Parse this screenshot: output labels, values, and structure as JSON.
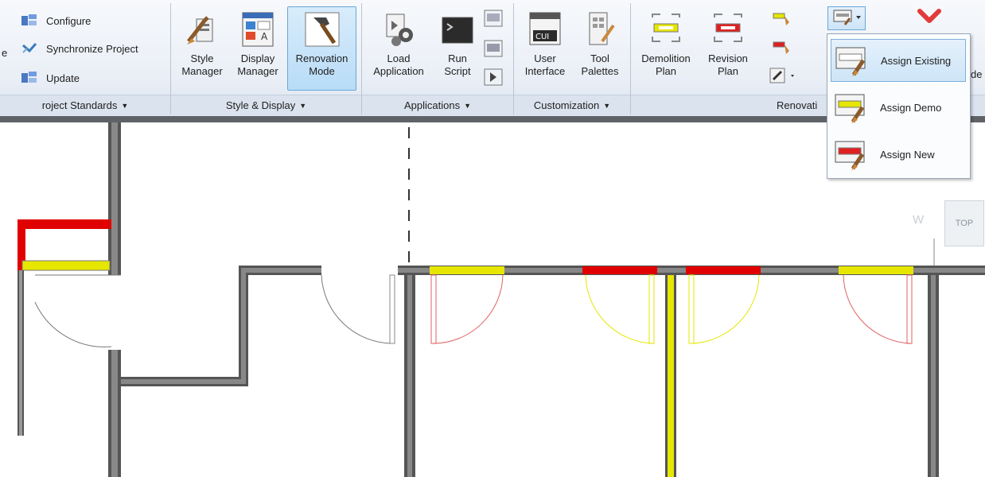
{
  "ribbon": {
    "project_standards": {
      "items": [
        "Configure",
        "Synchronize Project",
        "Update"
      ],
      "left_fragment_top": "",
      "left_fragment_mid": "e",
      "panel_label": "roject Standards"
    },
    "style_display": {
      "style_manager": [
        "Style",
        "Manager"
      ],
      "display_manager": [
        "Display",
        "Manager"
      ],
      "renovation_mode": [
        "Renovation",
        "Mode"
      ],
      "panel_label": "Style & Display"
    },
    "applications": {
      "load_application": [
        "Load",
        "Application"
      ],
      "run_script": [
        "Run",
        "Script"
      ],
      "panel_label": "Applications"
    },
    "customization": {
      "user_interface": [
        "User",
        "Interface"
      ],
      "tool_palettes": [
        "Tool",
        "Palettes"
      ],
      "cui_badge": "CUI",
      "panel_label": "Customization"
    },
    "renovation": {
      "demolition_plan": [
        "Demolition",
        "Plan"
      ],
      "revision_plan": [
        "Revision",
        "Plan"
      ],
      "panel_label": "Renovati",
      "right_fragment": "de"
    }
  },
  "dropdown": {
    "items": [
      "Assign Existing",
      "Assign Demo",
      "Assign New"
    ],
    "selected": 0
  },
  "viewcube": {
    "top_label": "TOP",
    "compass_w": "W"
  },
  "colors": {
    "existing": "#e6e600",
    "demo": "#ff0000",
    "new_wall": "#e00000",
    "wall": "#666666",
    "accent": "#6aa6d6"
  }
}
